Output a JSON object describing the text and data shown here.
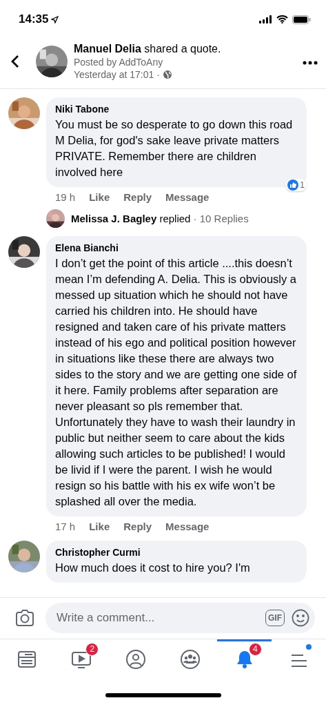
{
  "status_bar": {
    "time": "14:35"
  },
  "post": {
    "author": "Manuel Delia",
    "action": "shared a quote.",
    "posted_by": "Posted by AddToAny",
    "time": "Yesterday at 17:01 ·"
  },
  "comments": [
    {
      "author": "Niki Tabone",
      "text": "You must be so desperate to go down this road M Delia, for god's sake leave private matters PRIVATE. Remember there are children involved here",
      "age": "19 h",
      "actions": [
        "Like",
        "Reply",
        "Message"
      ],
      "reactions": "1",
      "reply_summary": {
        "name": "Melissa J. Bagley",
        "verb": "replied",
        "count": "· 10 Replies"
      }
    },
    {
      "author": "Elena Bianchi",
      "text": "I don’t get the point of this article ....this doesn’t mean I’m defending A. Delia. This is obviously a messed up situation which he should not have carried his children into. He should have resigned and taken care of his private matters instead of his ego and political position however in situations like these there are always two sides to the story and we are getting one side of it here. Family problems after separation are never pleasant so pls remember that. Unfortunately they have to wash their laundry in public but neither seem to care about the kids allowing such articles to be published! I would be livid if I were the parent. I wish he would resign so his battle with his ex wife won’t be splashed all over the media.",
      "age": "17 h",
      "actions": [
        "Like",
        "Reply",
        "Message"
      ]
    },
    {
      "author": "Christopher Curmi",
      "text": "How much does it cost to hire you? I'm"
    }
  ],
  "composer": {
    "placeholder": "Write a comment...",
    "gif": "GIF"
  },
  "tabs": [
    {
      "kind": "news",
      "selected": false
    },
    {
      "kind": "video",
      "selected": false,
      "badge": "2"
    },
    {
      "kind": "profile",
      "selected": false
    },
    {
      "kind": "groups",
      "selected": false
    },
    {
      "kind": "bell",
      "selected": true,
      "badge": "4"
    },
    {
      "kind": "menu",
      "selected": false,
      "dot": true
    }
  ]
}
